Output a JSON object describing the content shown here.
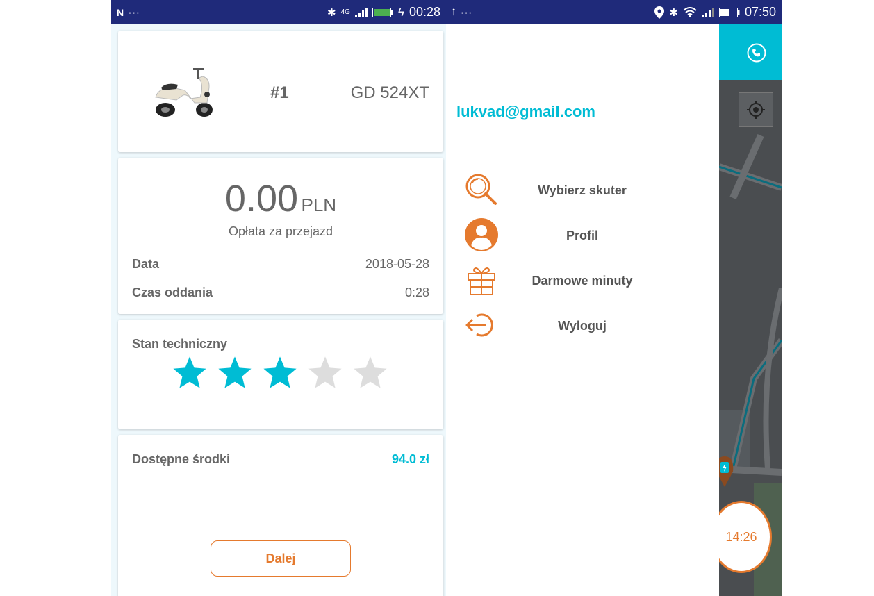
{
  "left_status": {
    "time": "00:28",
    "dots": "···",
    "network": "4G"
  },
  "right_status": {
    "time": "07:50",
    "dots": "···"
  },
  "ride": {
    "number": "#1",
    "plate": "GD 524XT",
    "amount": "0.00",
    "currency": "PLN",
    "fee_label": "Opłata za przejazd",
    "date_label": "Data",
    "date_value": "2018-05-28",
    "return_label": "Czas oddania",
    "return_value": "0:28"
  },
  "technical": {
    "label": "Stan techniczny",
    "rating": 3,
    "max": 5
  },
  "funds": {
    "label": "Dostępne środki",
    "value": "94.0 zł"
  },
  "next_button": "Dalej",
  "drawer": {
    "email": "lukvad@gmail.com",
    "items": [
      {
        "label": "Wybierz skuter",
        "icon": "search-icon"
      },
      {
        "label": "Profil",
        "icon": "profile-icon"
      },
      {
        "label": "Darmowe minuty",
        "icon": "gift-icon"
      },
      {
        "label": "Wyloguj",
        "icon": "logout-icon"
      }
    ]
  },
  "map": {
    "timer": "14:26"
  },
  "colors": {
    "accent": "#00bcd4",
    "orange": "#e57a2e",
    "statusbar": "#1f2a7a",
    "star_off": "#dddddd"
  }
}
